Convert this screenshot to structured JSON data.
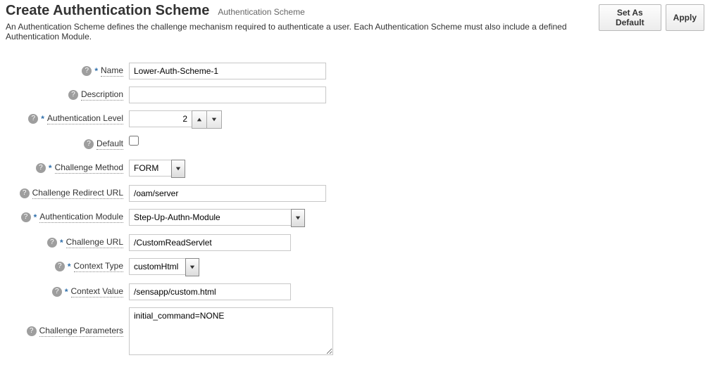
{
  "header": {
    "title": "Create Authentication Scheme",
    "breadcrumb": "Authentication Scheme",
    "subtitle": "An Authentication Scheme defines the challenge mechanism required to authenticate a user. Each Authentication Scheme must also include a defined Authentication Module.",
    "buttons": {
      "set_default": "Set As Default",
      "apply": "Apply"
    }
  },
  "labels": {
    "name": "Name",
    "description": "Description",
    "auth_level": "Authentication Level",
    "default": "Default",
    "challenge_method": "Challenge Method",
    "challenge_redirect_url": "Challenge Redirect URL",
    "auth_module": "Authentication Module",
    "challenge_url": "Challenge URL",
    "context_type": "Context Type",
    "context_value": "Context Value",
    "challenge_parameters": "Challenge Parameters"
  },
  "fields": {
    "name": "Lower-Auth-Scheme-1",
    "description": "",
    "auth_level": "2",
    "default_checked": false,
    "challenge_method": "FORM",
    "challenge_redirect_url": "/oam/server",
    "auth_module": "Step-Up-Authn-Module",
    "challenge_url": "/CustomReadServlet",
    "context_type": "customHtml",
    "context_value": "/sensapp/custom.html",
    "challenge_parameters": "initial_command=NONE"
  },
  "icons": {
    "help": "?"
  }
}
